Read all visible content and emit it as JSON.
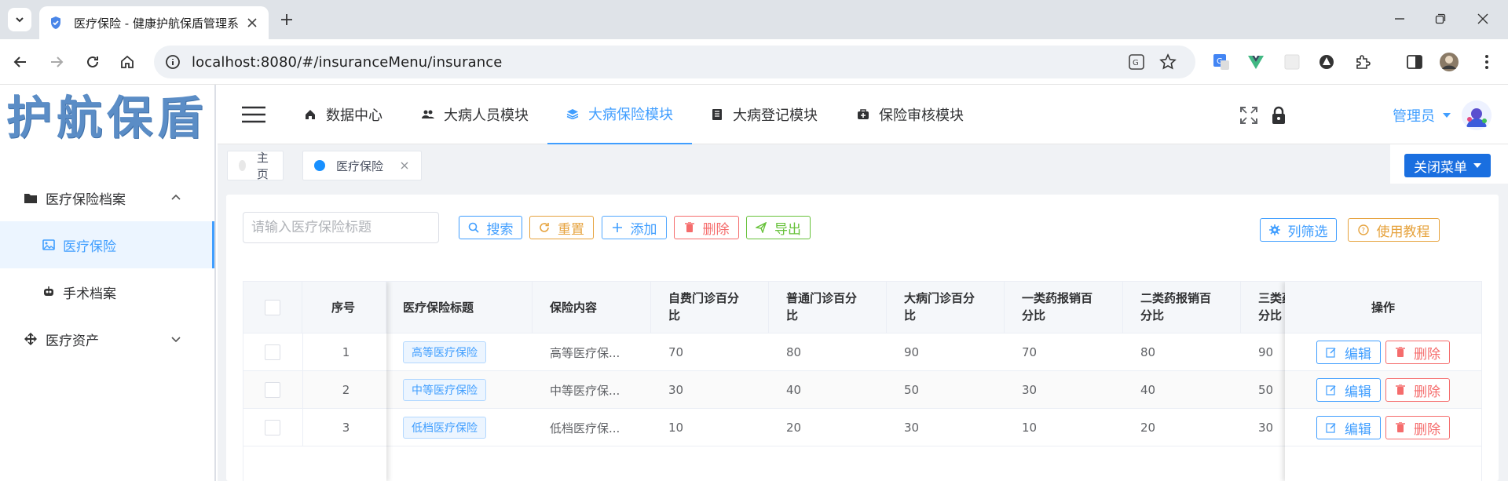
{
  "browser": {
    "tab_title": "医疗保险 - 健康护航保盾管理系",
    "url": "localhost:8080/#/insuranceMenu/insurance"
  },
  "logo_text": "护航保盾",
  "sidebar": {
    "items": [
      {
        "label": "医疗保险档案",
        "icon": "folder-icon",
        "expanded": true
      },
      {
        "label": "医疗保险",
        "icon": "image-icon",
        "active": true
      },
      {
        "label": "手术档案",
        "icon": "robot-icon"
      },
      {
        "label": "医疗资产",
        "icon": "move-icon",
        "expanded": false
      }
    ]
  },
  "header": {
    "nav": [
      {
        "label": "数据中心",
        "icon": "home-icon"
      },
      {
        "label": "大病人员模块",
        "icon": "users-icon"
      },
      {
        "label": "大病保险模块",
        "icon": "layers-icon",
        "active": true
      },
      {
        "label": "大病登记模块",
        "icon": "book-icon"
      },
      {
        "label": "保险审核模块",
        "icon": "medkit-icon"
      }
    ],
    "user": "管理员"
  },
  "tags": [
    {
      "label": "主页"
    },
    {
      "label": "医疗保险",
      "active": true
    }
  ],
  "close_menu_label": "关闭菜单",
  "toolbar": {
    "search_placeholder": "请输入医疗保险标题",
    "search": "搜索",
    "reset": "重置",
    "add": "添加",
    "delete": "删除",
    "export": "导出",
    "column_filter": "列筛选",
    "tutorial": "使用教程"
  },
  "table": {
    "headers": {
      "index": "序号",
      "title": "医疗保险标题",
      "content": "保险内容",
      "c1": [
        "自费门诊百分",
        "比"
      ],
      "c2": [
        "普通门诊百分",
        "比"
      ],
      "c3": [
        "大病门诊百分",
        "比"
      ],
      "c4": [
        "一类药报销百",
        "分比"
      ],
      "c5": [
        "二类药报销百",
        "分比"
      ],
      "c6": [
        "三类药",
        "分比"
      ],
      "ops": "操作"
    },
    "edit_label": "编辑",
    "delete_label": "删除",
    "rows": [
      {
        "index": "1",
        "title": "高等医疗保险",
        "content": "高等医疗保...",
        "c1": "70",
        "c2": "80",
        "c3": "90",
        "c4": "70",
        "c5": "80",
        "c6": "90"
      },
      {
        "index": "2",
        "title": "中等医疗保险",
        "content": "中等医疗保...",
        "c1": "30",
        "c2": "40",
        "c3": "50",
        "c4": "30",
        "c5": "40",
        "c6": "50"
      },
      {
        "index": "3",
        "title": "低档医疗保险",
        "content": "低档医疗保...",
        "c1": "10",
        "c2": "20",
        "c3": "30",
        "c4": "10",
        "c5": "20",
        "c6": "30"
      }
    ]
  }
}
